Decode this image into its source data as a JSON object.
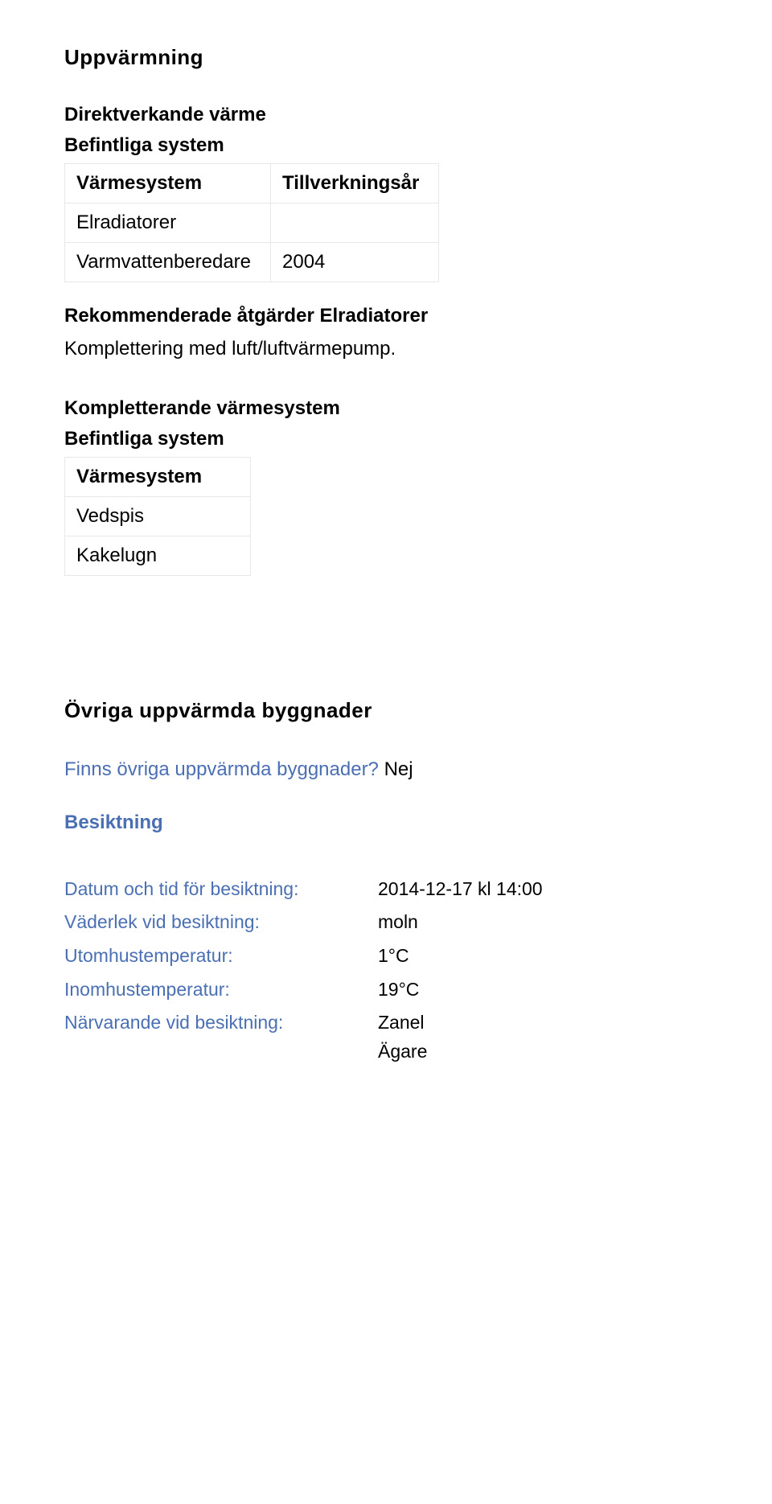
{
  "section_title": "Uppvärmning",
  "direkt": {
    "title": "Direktverkande värme",
    "subtitle": "Befintliga system",
    "headers": {
      "col1": "Värmesystem",
      "col2": "Tillverkningsår"
    },
    "rows": [
      {
        "col1": "Elradiatorer",
        "col2": ""
      },
      {
        "col1": "Varmvattenberedare",
        "col2": "2004"
      }
    ]
  },
  "rekommend": {
    "title": "Rekommenderade åtgärder Elradiatorer",
    "body": "Komplettering med luft/luftvärmepump."
  },
  "komplett": {
    "title": "Kompletterande värmesystem",
    "subtitle": "Befintliga system",
    "header": "Värmesystem",
    "rows": [
      "Vedspis",
      "Kakelugn"
    ]
  },
  "ovr_title": "Övriga uppvärmda byggnader",
  "ovr": {
    "label": "Finns övriga uppvärmda byggnader? ",
    "value": "Nej"
  },
  "besiktning_title": "Besiktning",
  "besiktning": [
    {
      "k": "Datum och tid för besiktning:",
      "v": "2014-12-17 kl 14:00"
    },
    {
      "k": "Väderlek vid besiktning:",
      "v": "moln"
    },
    {
      "k": "Utomhustemperatur:",
      "v": "1°C"
    },
    {
      "k": "Inomhustemperatur:",
      "v": "19°C"
    },
    {
      "k": "Närvarande vid besiktning:",
      "v": "Zanel\nÄgare"
    }
  ]
}
